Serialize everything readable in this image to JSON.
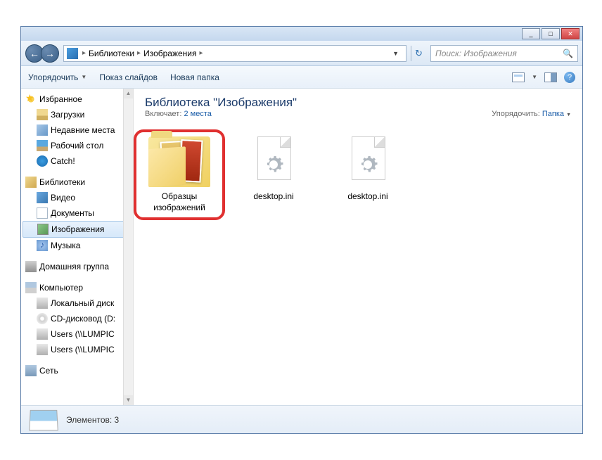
{
  "titlebar": {
    "min": "_",
    "max": "□",
    "close": "✕"
  },
  "nav": {
    "back": "←",
    "fwd": "→"
  },
  "address": {
    "crumb1": "Библиотеки",
    "crumb2": "Изображения",
    "dropdown": "▼",
    "refresh": "↻"
  },
  "search": {
    "placeholder": "Поиск: Изображения",
    "icon": "🔍"
  },
  "toolbar": {
    "organize": "Упорядочить",
    "slideshow": "Показ слайдов",
    "newfolder": "Новая папка",
    "help": "?"
  },
  "sidebar": {
    "favorites": "Избранное",
    "downloads": "Загрузки",
    "recent": "Недавние места",
    "desktop": "Рабочий стол",
    "catch": "Catch!",
    "libraries": "Библиотеки",
    "video": "Видео",
    "documents": "Документы",
    "images": "Изображения",
    "music": "Музыка",
    "homegroup": "Домашняя группа",
    "computer": "Компьютер",
    "localdisk": "Локальный диск",
    "cddrive": "CD-дисковод (D:",
    "users1": "Users (\\\\LUMPIC",
    "users2": "Users (\\\\LUMPIC",
    "network": "Сеть"
  },
  "header": {
    "title": "Библиотека \"Изображения\"",
    "includes_label": "Включает:",
    "includes_link": "2 места",
    "arrange_label": "Упорядочить:",
    "arrange_value": "Папка"
  },
  "items": [
    {
      "name": "Образцы изображений",
      "type": "folder"
    },
    {
      "name": "desktop.ini",
      "type": "ini"
    },
    {
      "name": "desktop.ini",
      "type": "ini"
    }
  ],
  "status": {
    "label": "Элементов: 3"
  }
}
